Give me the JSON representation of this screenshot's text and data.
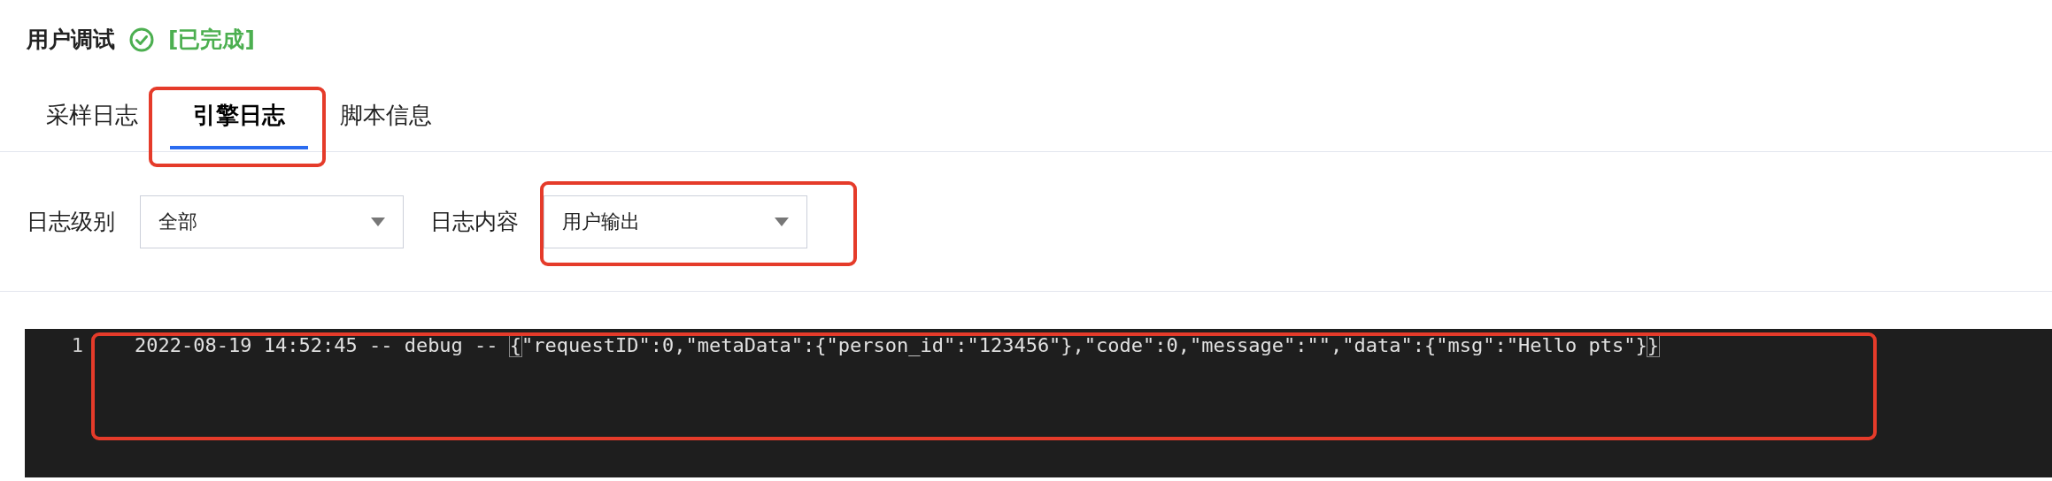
{
  "header": {
    "title": "用户调试",
    "status": "[已完成]"
  },
  "tabs": [
    {
      "label": "采样日志",
      "selected": false,
      "highlighted": false
    },
    {
      "label": "引擎日志",
      "selected": true,
      "highlighted": true
    },
    {
      "label": "脚本信息",
      "selected": false,
      "highlighted": false
    }
  ],
  "filters": [
    {
      "label": "日志级别",
      "value": "全部",
      "highlighted": false
    },
    {
      "label": "日志内容",
      "value": "用户输出",
      "highlighted": true
    }
  ],
  "log": {
    "highlighted": true,
    "lines": [
      {
        "number": "1",
        "prefix": "2022-08-19 14:52:45 -- debug -- ",
        "body": "{\"requestID\":0,\"metaData\":{\"person_id\":\"123456\"},\"code\":0,\"message\":\"\",\"data\":{\"msg\":\"Hello pts\"}}",
        "bracket_match": true
      }
    ]
  }
}
